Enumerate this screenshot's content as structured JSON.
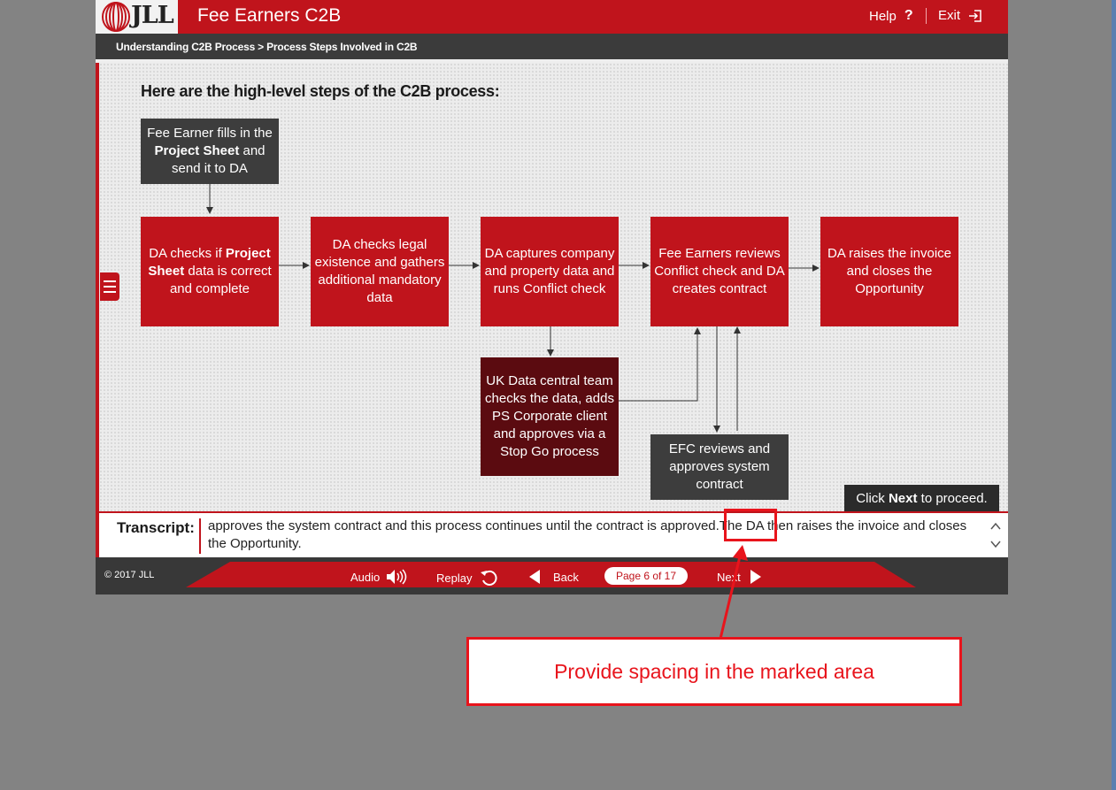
{
  "header": {
    "logo_text": "JLL",
    "app_title": "Fee Earners C2B",
    "help_label": "Help",
    "help_icon": "?",
    "exit_label": "Exit"
  },
  "breadcrumb": "Understanding C2B Process > Process Steps Involved in C2B",
  "content": {
    "heading": "Here are the high-level steps of the C2B process:",
    "steps": {
      "project_sheet": {
        "pre": "Fee Earner fills in the ",
        "bold": "Project Sheet",
        "post": " and send it to DA"
      },
      "da_checks": {
        "pre": "DA checks if ",
        "bold": "Project Sheet",
        "post": " data is correct and complete"
      },
      "legal": "DA checks legal existence and gathers additional mandatory data",
      "captures": "DA captures company and property data and runs Conflict check",
      "reviews": "Fee Earners reviews Conflict check and DA creates contract",
      "raises": "DA raises the invoice and closes the Opportunity",
      "uk_data": "UK Data central team checks the data, adds PS Corporate client and approves via a Stop Go process",
      "efc": "EFC reviews and approves system contract"
    },
    "proceed": {
      "pre": "Click ",
      "bold": "Next",
      "post": " to proceed."
    }
  },
  "transcript": {
    "label": "Transcript:",
    "text": "approves the system contract and this process continues until the contract is approved.The DA then raises the invoice and closes the Opportunity."
  },
  "footer": {
    "copyright": "© 2017 JLL",
    "audio": "Audio",
    "replay": "Replay",
    "back": "Back",
    "page": "Page 6 of 17",
    "next": "Next"
  },
  "annotation": {
    "callout": "Provide spacing in the marked area",
    "color": "#e8141c"
  },
  "colors": {
    "brand_red": "#c0141c",
    "dark_box": "#3d3d3d",
    "maroon_box": "#5b0b10",
    "background": "#838383"
  }
}
